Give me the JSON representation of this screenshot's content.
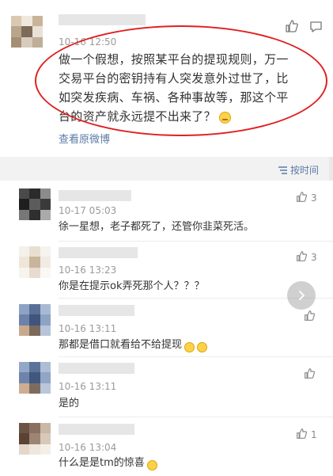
{
  "colors": {
    "accent_link": "#5b7aa6",
    "highlight_red": "#e02020",
    "text_primary": "#333333",
    "text_muted": "#9a9a9a"
  },
  "main_post": {
    "time": "10-16 12:50",
    "text": "做一个假想，按照某平台的提现规则，万一交易平台的密钥持有人突发意外过世了，比如突发疾病、车祸、各种事故等，那这个平台的资产就永远提不出来了？",
    "emoji": "sweat-smile-emoji",
    "view_original_label": "查看原微博"
  },
  "sort": {
    "label": "按时间",
    "icon": "sort-lines-icon"
  },
  "comments": [
    {
      "time": "10-17 05:03",
      "text": "徐一星想，老子都死了，还管你韭菜死活。",
      "likes": "3",
      "emojis": []
    },
    {
      "time": "10-16 13:23",
      "text": "你是在提示ok弄死那个人？？？",
      "likes": "3",
      "emojis": []
    },
    {
      "time": "10-16 13:11",
      "text": "那都是借口就看给不给提现",
      "likes": "",
      "emojis": [
        "laugh-cry-emoji",
        "laugh-cry-emoji"
      ]
    },
    {
      "time": "10-16 13:11",
      "text": "是的",
      "likes": "",
      "emojis": []
    },
    {
      "time": "10-16 13:04",
      "text": "什么是是tm的惊喜",
      "likes": "1",
      "emojis": [
        "slight-smile-emoji"
      ]
    }
  ]
}
